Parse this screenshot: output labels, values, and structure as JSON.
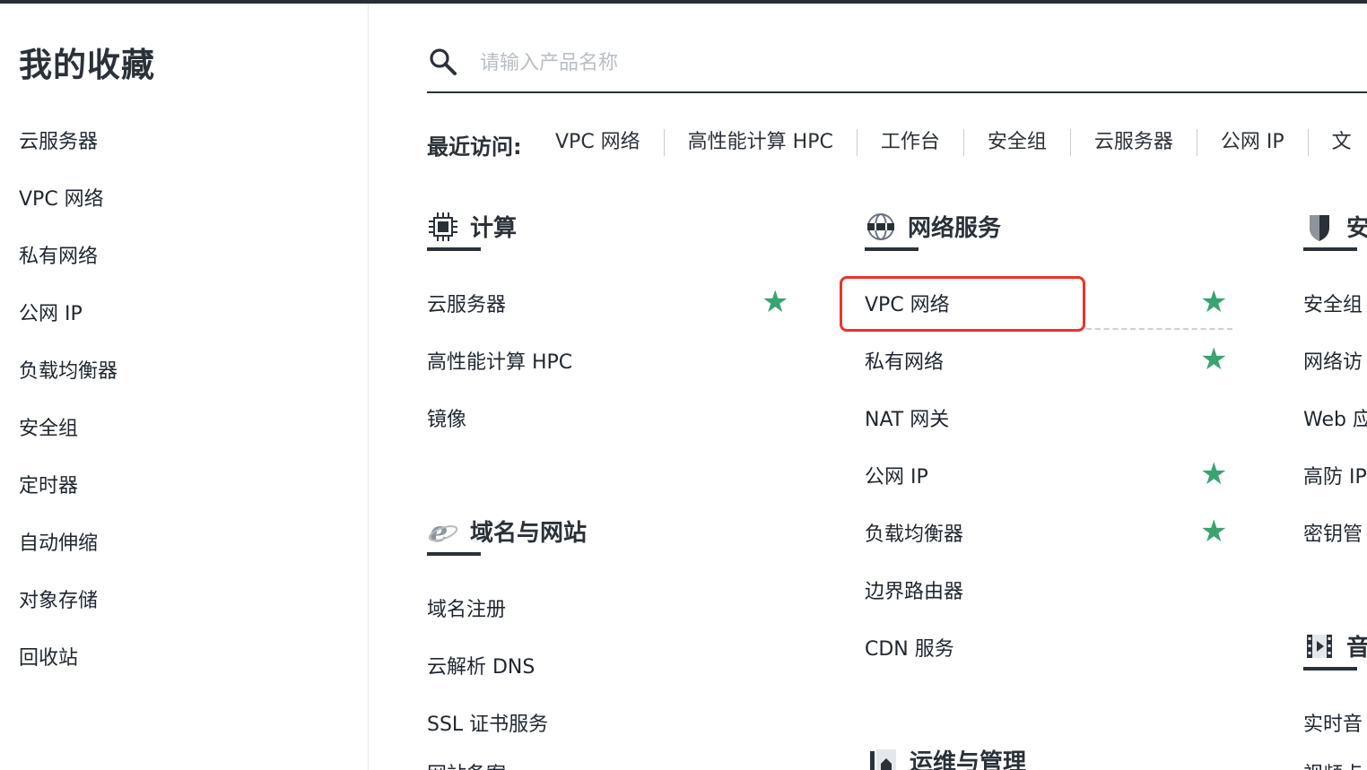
{
  "sidebar": {
    "title": "我的收藏",
    "items": [
      "云服务器",
      "VPC 网络",
      "私有网络",
      "公网 IP",
      "负载均衡器",
      "安全组",
      "定时器",
      "自动伸缩",
      "对象存储",
      "回收站"
    ]
  },
  "search": {
    "placeholder": "请输入产品名称",
    "value": "",
    "icon": "search-icon"
  },
  "recent": {
    "label": "最近访问:",
    "items": [
      "VPC 网络",
      "高性能计算 HPC",
      "工作台",
      "安全组",
      "云服务器",
      "公网 IP",
      "文"
    ]
  },
  "categories": {
    "compute": {
      "title": "计算",
      "icon": "chip-icon",
      "items": [
        {
          "label": "云服务器",
          "favorited": true
        },
        {
          "label": "高性能计算 HPC",
          "favorited": false
        },
        {
          "label": "镜像",
          "favorited": false
        }
      ]
    },
    "domain": {
      "title": "域名与网站",
      "icon": "ie-browser-icon",
      "items": [
        {
          "label": "域名注册",
          "favorited": false
        },
        {
          "label": "云解析 DNS",
          "favorited": false
        },
        {
          "label": "SSL 证书服务",
          "favorited": false
        },
        {
          "label": "网站备案",
          "favorited": false
        }
      ]
    },
    "network": {
      "title": "网络服务",
      "icon": "globe-icon",
      "items": [
        {
          "label": "VPC 网络",
          "favorited": true,
          "highlighted": true
        },
        {
          "label": "私有网络",
          "favorited": true
        },
        {
          "label": "NAT 网关",
          "favorited": false
        },
        {
          "label": "公网 IP",
          "favorited": true
        },
        {
          "label": "负载均衡器",
          "favorited": true
        },
        {
          "label": "边界路由器",
          "favorited": false
        },
        {
          "label": "CDN 服务",
          "favorited": false
        }
      ]
    },
    "ops": {
      "title": "运维与管理",
      "icon": "tools-icon"
    },
    "security": {
      "title": "安",
      "icon": "shield-icon",
      "items": [
        "安全组",
        "网络访",
        "Web 应",
        "高防 IP",
        "密钥管"
      ]
    },
    "media": {
      "title": "音",
      "icon": "film-icon",
      "items": [
        "实时音",
        "视频点"
      ]
    }
  },
  "colors": {
    "accent_star": "#3aa471",
    "highlight": "#e8352a",
    "text": "#1f2630",
    "header_bar": "#2a2f36"
  }
}
